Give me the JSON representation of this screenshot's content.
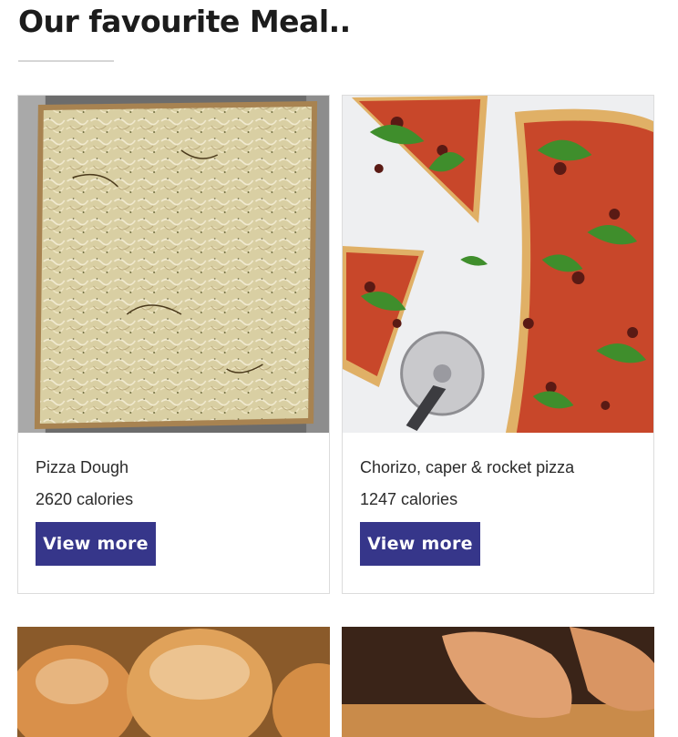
{
  "section": {
    "title": "Our favourite Meal.."
  },
  "meals": [
    {
      "name": "Pizza Dough",
      "calories": "2620 calories",
      "button_label": "View more",
      "image": "focaccia-onion-flatbread-photo"
    },
    {
      "name": "Chorizo, caper & rocket pizza",
      "calories": "1247 calories",
      "button_label": "View more",
      "image": "chorizo-rocket-pizza-photo"
    },
    {
      "image": "sugared-doughnuts-photo"
    },
    {
      "image": "hands-making-pastry-photo"
    }
  ],
  "colors": {
    "button_bg": "#36368a",
    "button_text": "#ffffff",
    "divider": "#d6d6d6"
  }
}
